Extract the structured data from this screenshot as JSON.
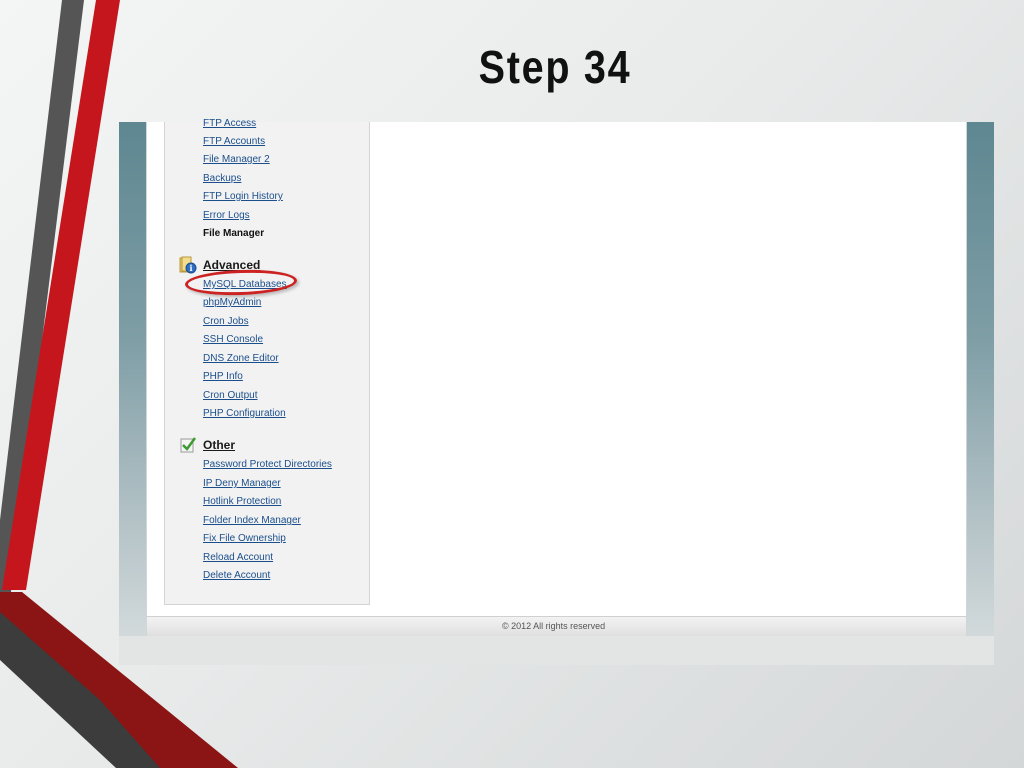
{
  "slide": {
    "title": "Step 34"
  },
  "sidebar": {
    "file_links": [
      {
        "label": "FTP Access"
      },
      {
        "label": "FTP Accounts"
      },
      {
        "label": "File Manager 2"
      },
      {
        "label": "Backups"
      },
      {
        "label": "FTP Login History"
      },
      {
        "label": "Error Logs"
      },
      {
        "label": "File Manager",
        "current": true
      }
    ],
    "advanced": {
      "heading": "Advanced",
      "icon": "folder-info-icon",
      "links": [
        {
          "label": "MySQL Databases",
          "highlighted": true
        },
        {
          "label": "phpMyAdmin"
        },
        {
          "label": "Cron Jobs"
        },
        {
          "label": "SSH Console"
        },
        {
          "label": "DNS Zone Editor"
        },
        {
          "label": "PHP Info"
        },
        {
          "label": "Cron Output"
        },
        {
          "label": "PHP Configuration"
        }
      ]
    },
    "other": {
      "heading": "Other",
      "icon": "checklist-icon",
      "links": [
        {
          "label": "Password Protect Directories"
        },
        {
          "label": "IP Deny Manager"
        },
        {
          "label": "Hotlink Protection"
        },
        {
          "label": "Folder Index Manager"
        },
        {
          "label": "Fix File Ownership"
        },
        {
          "label": "Reload Account"
        },
        {
          "label": "Delete Account"
        }
      ]
    }
  },
  "footer": {
    "copyright": "© 2012 All rights reserved"
  },
  "colors": {
    "link": "#1b4f8c",
    "highlight_oval": "#cc2222",
    "accent_red": "#c4161c"
  }
}
